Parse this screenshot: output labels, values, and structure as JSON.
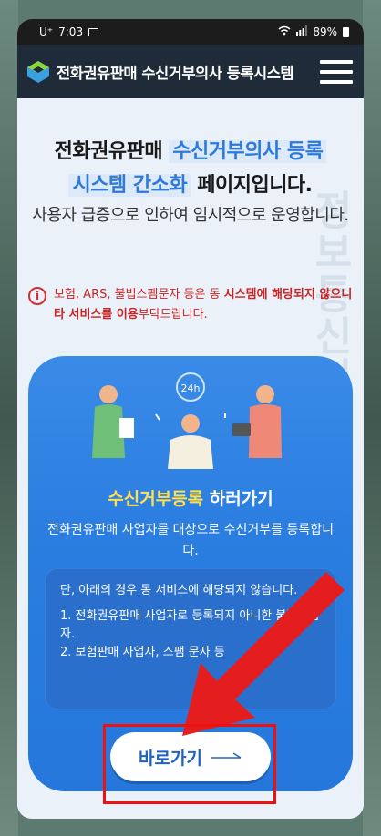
{
  "status": {
    "carrier": "U⁺",
    "time": "7:03",
    "battery": "89%"
  },
  "app": {
    "title": "전화권유판매 수신거부의사 등록시스템"
  },
  "headline": {
    "part1": "전화권유판매",
    "part2": "수신거부의사 등록",
    "part3": "시스템 간소화",
    "part4": "페이지입니다."
  },
  "subline": "사용자 급증으로 인하여 임시적으로 운영합니다.",
  "notice": {
    "icon": "i",
    "text1": "보험, ARS, 불법스팸문자 등은 동",
    "bold1": "시스템에 해당되지 않으니 타 서비스를 이용",
    "text2": "부탁드립니다."
  },
  "watermark": "정보통신정책연구원",
  "card": {
    "badge": "24h",
    "title_highlight": "수신거부등록",
    "title_rest": " 하러가기",
    "desc": "전화권유판매 사업자를 대상으로 수신거부를 등록합니다.",
    "info_line1": "단, 아래의 경우 동 서비스에 해당되지 않습니다.",
    "info_line2": "1. 전화권유판매 사업자로 등록되지 아니한 불법사업자.",
    "info_line3": "2. 보험판매 사업자, 스팸 문자 등",
    "button_label": "바로가기"
  },
  "colors": {
    "accent": "#2b7ee0",
    "header": "#1f2b38",
    "warning": "#cc2222",
    "highlight": "#ffe04d"
  }
}
